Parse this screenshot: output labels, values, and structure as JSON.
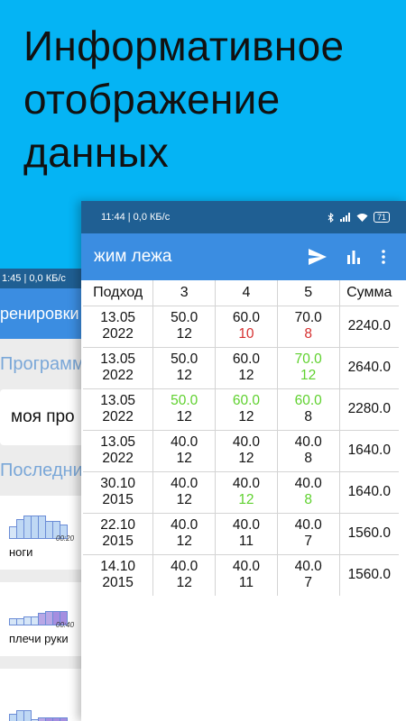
{
  "headline": [
    "Информативное",
    "отображение",
    "данных"
  ],
  "back_phone": {
    "status": "1:45 | 0,0 КБ/с",
    "toolbar_title": "ренировки",
    "programs_label": "Программ",
    "program_item": "моя про",
    "recent_label": "Последни",
    "workouts": [
      {
        "name": "ноги",
        "time": "00:20"
      },
      {
        "name": "плечи руки",
        "time": "00:40"
      }
    ]
  },
  "phone": {
    "status": {
      "time_speed": "11:44 | 0,0 КБ/с",
      "battery": "71"
    },
    "toolbar": {
      "title": "жим лежа",
      "icons": [
        "send-icon",
        "bar-chart-icon",
        "more-vert-icon"
      ]
    },
    "table": {
      "headers": [
        "Подход",
        "3",
        "4",
        "5",
        "Сумма"
      ],
      "rows": [
        {
          "date": [
            "13.05",
            "2022"
          ],
          "sets": [
            {
              "weight": "50.0",
              "reps": "12",
              "weight_color": "",
              "reps_color": ""
            },
            {
              "weight": "60.0",
              "reps": "10",
              "weight_color": "",
              "reps_color": "red"
            },
            {
              "weight": "70.0",
              "reps": "8",
              "weight_color": "",
              "reps_color": "red"
            }
          ],
          "sum": "2240.0"
        },
        {
          "date": [
            "13.05",
            "2022"
          ],
          "sets": [
            {
              "weight": "50.0",
              "reps": "12",
              "weight_color": "",
              "reps_color": ""
            },
            {
              "weight": "60.0",
              "reps": "12",
              "weight_color": "",
              "reps_color": ""
            },
            {
              "weight": "70.0",
              "reps": "12",
              "weight_color": "green",
              "reps_color": "green"
            }
          ],
          "sum": "2640.0"
        },
        {
          "date": [
            "13.05",
            "2022"
          ],
          "sets": [
            {
              "weight": "50.0",
              "reps": "12",
              "weight_color": "green",
              "reps_color": ""
            },
            {
              "weight": "60.0",
              "reps": "12",
              "weight_color": "green",
              "reps_color": ""
            },
            {
              "weight": "60.0",
              "reps": "8",
              "weight_color": "green",
              "reps_color": ""
            }
          ],
          "sum": "2280.0"
        },
        {
          "date": [
            "13.05",
            "2022"
          ],
          "sets": [
            {
              "weight": "40.0",
              "reps": "12",
              "weight_color": "",
              "reps_color": ""
            },
            {
              "weight": "40.0",
              "reps": "12",
              "weight_color": "",
              "reps_color": ""
            },
            {
              "weight": "40.0",
              "reps": "8",
              "weight_color": "",
              "reps_color": ""
            }
          ],
          "sum": "1640.0"
        },
        {
          "date": [
            "30.10",
            "2015"
          ],
          "sets": [
            {
              "weight": "40.0",
              "reps": "12",
              "weight_color": "",
              "reps_color": ""
            },
            {
              "weight": "40.0",
              "reps": "12",
              "weight_color": "",
              "reps_color": "green"
            },
            {
              "weight": "40.0",
              "reps": "8",
              "weight_color": "",
              "reps_color": "green"
            }
          ],
          "sum": "1640.0"
        },
        {
          "date": [
            "22.10",
            "2015"
          ],
          "sets": [
            {
              "weight": "40.0",
              "reps": "12",
              "weight_color": "",
              "reps_color": ""
            },
            {
              "weight": "40.0",
              "reps": "11",
              "weight_color": "",
              "reps_color": ""
            },
            {
              "weight": "40.0",
              "reps": "7",
              "weight_color": "",
              "reps_color": ""
            }
          ],
          "sum": "1560.0"
        },
        {
          "date": [
            "14.10",
            "2015"
          ],
          "sets": [
            {
              "weight": "40.0",
              "reps": "12",
              "weight_color": "",
              "reps_color": ""
            },
            {
              "weight": "40.0",
              "reps": "11",
              "weight_color": "",
              "reps_color": ""
            },
            {
              "weight": "40.0",
              "reps": "7",
              "weight_color": "",
              "reps_color": ""
            }
          ],
          "sum": "1560.0"
        }
      ]
    }
  },
  "colors": {
    "background": "#05b4f4",
    "status_bar": "#1f5f93",
    "toolbar": "#3b8de1",
    "improved": "#5fd12e",
    "decreased": "#d63030"
  }
}
